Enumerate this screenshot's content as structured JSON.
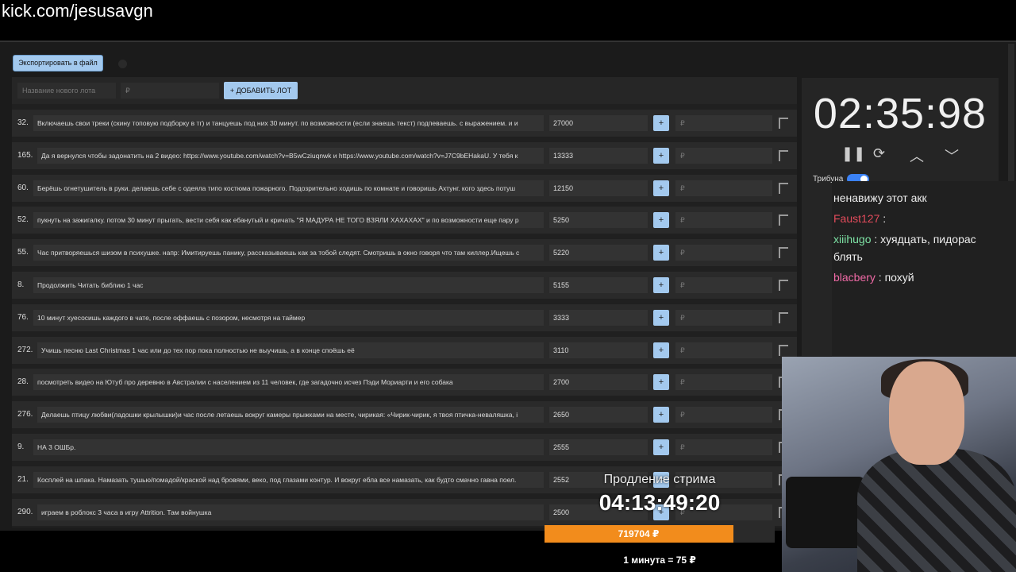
{
  "url": "kick.com/jesusavgn",
  "toolbar": {
    "export_label": "Экспортировать в файл"
  },
  "add_lot": {
    "name_placeholder": "Название нового лота",
    "currency_placeholder": "₽",
    "add_label": "+ ДОБАВИТЬ ЛОТ"
  },
  "lots": [
    {
      "num": "32.",
      "desc": "Включаешь свои треки (скину топовую подборку в тг) и танцуешь под них 30 минут. по возможности (если знаешь текст) подпеваешь. с выражением. и и",
      "amount": "27000"
    },
    {
      "num": "165.",
      "desc": "Да я вернулся чтобы задонатить на 2 видео: https://www.youtube.com/watch?v=B5wCziuqnwk и https://www.youtube.com/watch?v=J7C9bEHakaU. У тебя к",
      "amount": "13333"
    },
    {
      "num": "60.",
      "desc": "Берёшь огнетушитель в руки. делаешь себе с одеяла типо костюма пожарного. Подозрительно ходишь по комнате и говоришь Ахтунг. кого здесь потуш",
      "amount": "12150"
    },
    {
      "num": "52.",
      "desc": "пукнуть на зажигалку. потом 30 минут прыгать, вести себя как ебанутый и кричать \"Я МАДУРА НЕ ТОГО ВЗЯЛИ ХАХАХАХ\" и по возможности еще пару р",
      "amount": "5250"
    },
    {
      "num": "55.",
      "desc": "Час притворяешься шизом в психушке. напр: Имитируешь панику, рассказываешь как за тобой следят. Смотришь в окно говоря что там киллер.Ищешь с",
      "amount": "5220"
    },
    {
      "num": "8.",
      "desc": "Продолжить Читать библию 1 час",
      "amount": "5155"
    },
    {
      "num": "76.",
      "desc": "10 минут хуесосишь каждого в чате, после оффаешь с позором, несмотря на таймер",
      "amount": "3333"
    },
    {
      "num": "272.",
      "desc": "Учишь песню Last Christmas 1 час или до тех пор пока полностью не выучишь, а в конце споёшь её",
      "amount": "3110"
    },
    {
      "num": "28.",
      "desc": "посмотреть видео на Ютуб про деревню в Австралии с населением из 11 человек, где загадочно исчез Пэди Мориарти и его собака",
      "amount": "2700"
    },
    {
      "num": "276.",
      "desc": "Делаешь птицу любви(ладошки крылышки)и час после летаешь вокруг камеры прыжками на месте, чирикая: «Чирик-чирик, я твоя птичка-неваляшка, і",
      "amount": "2650"
    },
    {
      "num": "9.",
      "desc": "НА 3 ОШБр.",
      "amount": "2555"
    },
    {
      "num": "21.",
      "desc": "Косплей на шпака. Намазать тушью/помадой/краской над бровями, веко, под глазами контур. И вокруг ебла все намазать, как будто смачно гавна поел.",
      "amount": "2552"
    },
    {
      "num": "290.",
      "desc": "играем в роблокс 3 часа в игру Attrition. Там войнушка",
      "amount": "2500"
    }
  ],
  "lot_plus_label": "+",
  "lot_currency": "₽",
  "timer": {
    "value": "02:35:98"
  },
  "tribune_label": "Трибуна",
  "chat": [
    {
      "user": "",
      "text": "ненавижу этот акк",
      "color": "#eeeeee"
    },
    {
      "user": "Faust127",
      "text": " :",
      "color": "#e24b5b"
    },
    {
      "user": "xiiihugo",
      "text": " : хуядцать, пидорас",
      "color": "#7ee3a5"
    },
    {
      "user": "",
      "text": "блять",
      "color": "#eeeeee"
    },
    {
      "user": "blacbery",
      "text": " : похуй",
      "color": "#f06aa6"
    }
  ],
  "extension": {
    "label": "Продление стрима",
    "timer": "04:13:49:20",
    "amount": "719704 ₽",
    "progress": 0.82,
    "rate": "1 минута = 75 ₽"
  }
}
